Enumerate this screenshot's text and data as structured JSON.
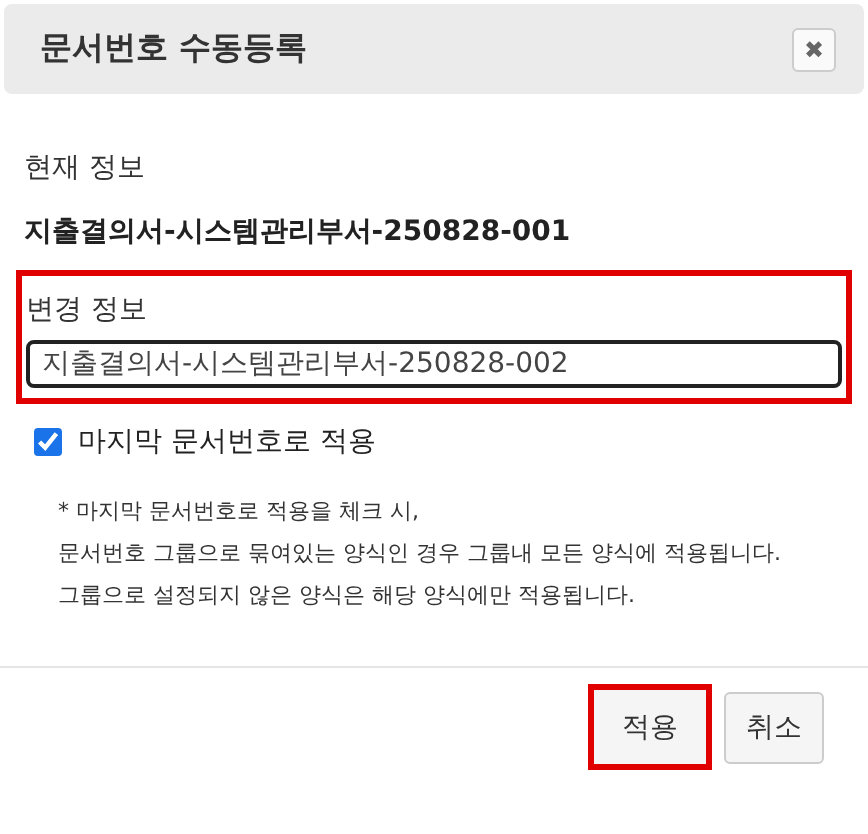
{
  "dialog": {
    "title": "문서번호 수동등록",
    "close_icon": "✖"
  },
  "current": {
    "label": "현재 정보",
    "value": "지출결의서-시스템관리부서-250828-001"
  },
  "change": {
    "label": "변경 정보",
    "value": "지출결의서-시스템관리부서-250828-002",
    "highlighted": true
  },
  "apply_last": {
    "label": "마지막 문서번호로 적용",
    "checked": true
  },
  "notes": [
    "* 마지막 문서번호로 적용을 체크 시,",
    "문서번호 그룹으로 묶여있는 양식인 경우 그룹내 모든 양식에 적용됩니다.",
    "그룹으로 설정되지 않은 양식은 해당 양식에만 적용됩니다."
  ],
  "buttons": [
    {
      "label": "적용",
      "highlighted": true
    },
    {
      "label": "취소",
      "highlighted": false
    }
  ]
}
